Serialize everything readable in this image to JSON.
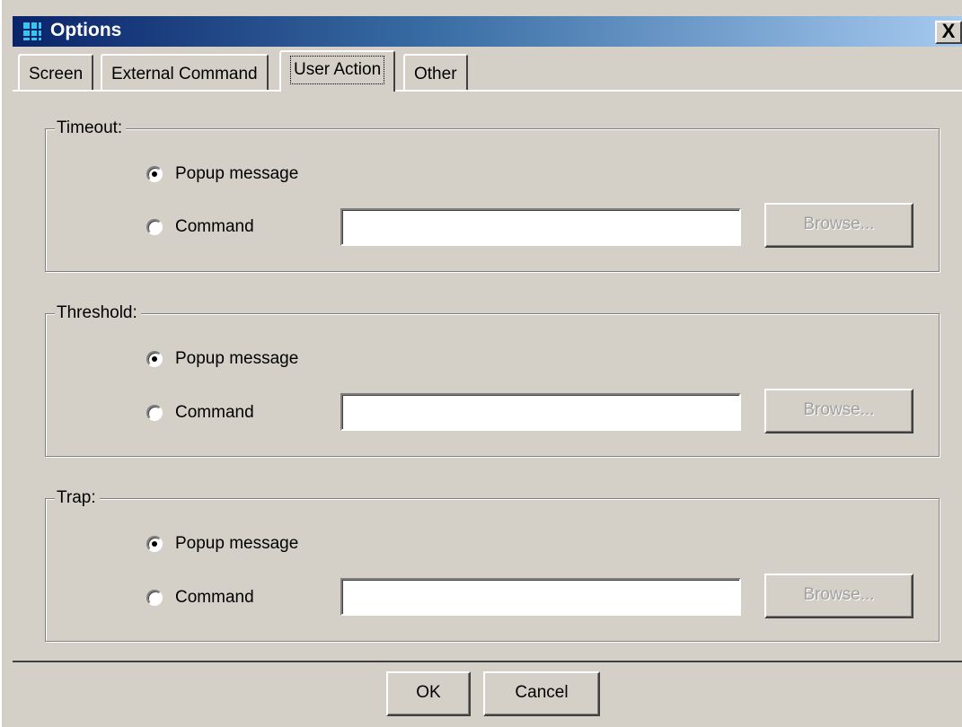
{
  "window": {
    "title": "Options",
    "close_label": "X"
  },
  "tabs": [
    {
      "label": "Screen",
      "active": false
    },
    {
      "label": "External Command",
      "active": false
    },
    {
      "label": "User Action",
      "active": true
    },
    {
      "label": "Other",
      "active": false
    }
  ],
  "groups": [
    {
      "legend": "Timeout:",
      "popup_label": "Popup message",
      "command_label": "Command",
      "selected": "popup",
      "command_value": "",
      "browse_label": "Browse..."
    },
    {
      "legend": "Threshold:",
      "popup_label": "Popup message",
      "command_label": "Command",
      "selected": "popup",
      "command_value": "",
      "browse_label": "Browse..."
    },
    {
      "legend": "Trap:",
      "popup_label": "Popup message",
      "command_label": "Command",
      "selected": "popup",
      "command_value": "",
      "browse_label": "Browse..."
    }
  ],
  "footer": {
    "ok_label": "OK",
    "cancel_label": "Cancel"
  },
  "icons": {
    "app": "grid-app-icon",
    "close": "close-icon"
  },
  "colors": {
    "face": "#d4d0c8",
    "title_start": "#0a246a",
    "title_end": "#a6caf0",
    "disabled_text": "#a0a0a0"
  }
}
